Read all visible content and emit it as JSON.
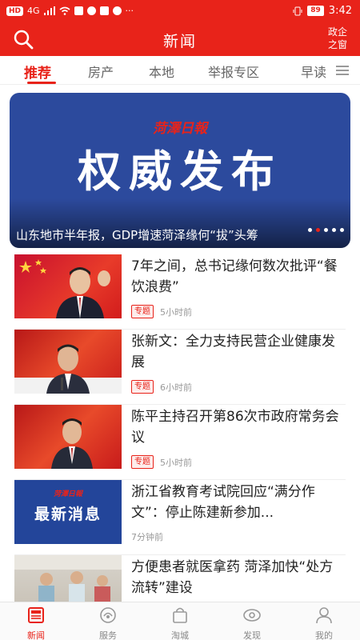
{
  "status_bar": {
    "network": "HD",
    "signal": "4G",
    "battery": "89",
    "time": "3:42"
  },
  "header": {
    "title": "新闻",
    "right_link": "政企之窗"
  },
  "tabs": [
    {
      "label": "推荐",
      "active": true
    },
    {
      "label": "房产",
      "active": false
    },
    {
      "label": "本地",
      "active": false
    },
    {
      "label": "举报专区",
      "active": false
    },
    {
      "label": "早读",
      "active": false
    }
  ],
  "banner": {
    "masthead": "菏澤日報",
    "headline": "权威发布",
    "caption": "山东地市半年报，GDP增速菏泽缘何“拔”头筹",
    "slides": 5,
    "active_slide": 2
  },
  "news": [
    {
      "title": "7年之间，总书记缘何数次批评“餐饮浪费”",
      "tag": "专题",
      "time": "5小时前"
    },
    {
      "title": "张新文：全力支持民营企业健康发展",
      "tag": "专题",
      "time": "6小时前"
    },
    {
      "title": "陈平主持召开第86次市政府常务会议",
      "tag": "专题",
      "time": "5小时前"
    },
    {
      "title": "浙江省教育考试院回应“满分作文”：停止陈建新参加...",
      "tag": "",
      "time": "7分钟前",
      "thumb_masthead": "菏澤日報",
      "thumb_text": "最新消息"
    },
    {
      "title": "方便患者就医拿药 菏泽加快“处方流转”建设",
      "tag": "",
      "time": ""
    }
  ],
  "bottom_nav": [
    {
      "label": "新闻",
      "icon": "news-icon",
      "active": true
    },
    {
      "label": "服务",
      "icon": "service-icon",
      "active": false
    },
    {
      "label": "淘城",
      "icon": "shopping-bag-icon",
      "active": false
    },
    {
      "label": "发现",
      "icon": "discover-icon",
      "active": false
    },
    {
      "label": "我的",
      "icon": "profile-icon",
      "active": false
    }
  ],
  "colors": {
    "brand": "#e8231a",
    "banner_bg": "#2c4a9d"
  }
}
